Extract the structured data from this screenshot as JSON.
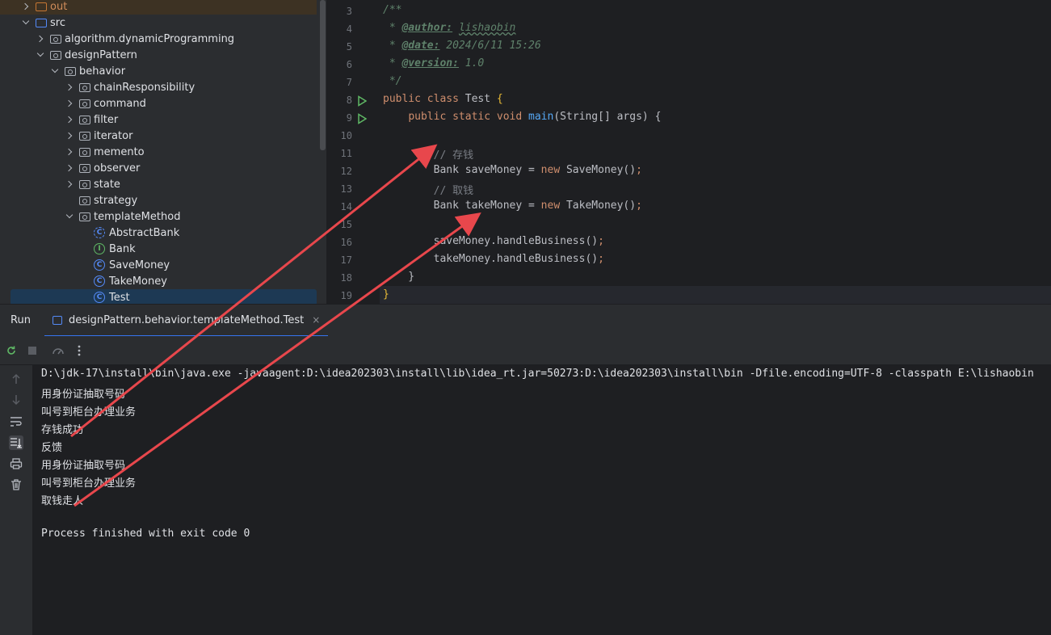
{
  "project_tree": {
    "items": [
      {
        "label": "out",
        "indent": 0,
        "chevron": "right",
        "icon": "folder-orange",
        "label_class": "orange",
        "highlight": true
      },
      {
        "label": "src",
        "indent": 0,
        "chevron": "down",
        "icon": "folder-blue"
      },
      {
        "label": "algorithm.dynamicProgramming",
        "indent": 1,
        "chevron": "right",
        "icon": "package"
      },
      {
        "label": "designPattern",
        "indent": 1,
        "chevron": "down",
        "icon": "package"
      },
      {
        "label": "behavior",
        "indent": 2,
        "chevron": "down",
        "icon": "package"
      },
      {
        "label": "chainResponsibility",
        "indent": 3,
        "chevron": "right",
        "icon": "package"
      },
      {
        "label": "command",
        "indent": 3,
        "chevron": "right",
        "icon": "package"
      },
      {
        "label": "filter",
        "indent": 3,
        "chevron": "right",
        "icon": "package"
      },
      {
        "label": "iterator",
        "indent": 3,
        "chevron": "right",
        "icon": "package"
      },
      {
        "label": "memento",
        "indent": 3,
        "chevron": "right",
        "icon": "package"
      },
      {
        "label": "observer",
        "indent": 3,
        "chevron": "right",
        "icon": "package"
      },
      {
        "label": "state",
        "indent": 3,
        "chevron": "right",
        "icon": "package"
      },
      {
        "label": "strategy",
        "indent": 3,
        "chevron": "none",
        "icon": "package"
      },
      {
        "label": "templateMethod",
        "indent": 3,
        "chevron": "down",
        "icon": "package"
      },
      {
        "label": "AbstractBank",
        "indent": 4,
        "chevron": "none",
        "icon": "abstract-class"
      },
      {
        "label": "Bank",
        "indent": 4,
        "chevron": "none",
        "icon": "interface"
      },
      {
        "label": "SaveMoney",
        "indent": 4,
        "chevron": "none",
        "icon": "class"
      },
      {
        "label": "TakeMoney",
        "indent": 4,
        "chevron": "none",
        "icon": "class"
      },
      {
        "label": "Test",
        "indent": 4,
        "chevron": "none",
        "icon": "class",
        "selected": true
      }
    ]
  },
  "editor": {
    "lines": [
      {
        "num": "3",
        "tokens": [
          [
            "cmt-doc",
            "/**"
          ]
        ]
      },
      {
        "num": "4",
        "tokens": [
          [
            "doc",
            " * "
          ],
          [
            "doctag",
            "@author:"
          ],
          [
            "doc",
            " "
          ],
          [
            "doc-u",
            "lishaobin"
          ]
        ]
      },
      {
        "num": "5",
        "tokens": [
          [
            "doc",
            " * "
          ],
          [
            "doctag",
            "@date:"
          ],
          [
            "doc",
            " 2024/6/11 15:26"
          ]
        ]
      },
      {
        "num": "6",
        "tokens": [
          [
            "doc",
            " * "
          ],
          [
            "doctag",
            "@version:"
          ],
          [
            "doc",
            " 1.0"
          ]
        ]
      },
      {
        "num": "7",
        "tokens": [
          [
            "doc",
            " */"
          ]
        ]
      },
      {
        "num": "8",
        "run": true,
        "tokens": [
          [
            "kw",
            "public class "
          ],
          [
            "plain",
            "Test "
          ],
          [
            "brace",
            "{"
          ]
        ]
      },
      {
        "num": "9",
        "run": true,
        "tokens": [
          [
            "plain",
            "    "
          ],
          [
            "kw",
            "public static void "
          ],
          [
            "fn",
            "main"
          ],
          [
            "plain",
            "(String[] args) {"
          ]
        ]
      },
      {
        "num": "10",
        "tokens": []
      },
      {
        "num": "11",
        "tokens": [
          [
            "plain",
            "        "
          ],
          [
            "cmt",
            "// 存钱"
          ]
        ]
      },
      {
        "num": "12",
        "tokens": [
          [
            "plain",
            "        Bank saveMoney = "
          ],
          [
            "kw",
            "new "
          ],
          [
            "plain",
            "SaveMoney()"
          ],
          [
            "kw",
            ";"
          ]
        ]
      },
      {
        "num": "13",
        "tokens": [
          [
            "plain",
            "        "
          ],
          [
            "cmt",
            "// 取钱"
          ]
        ]
      },
      {
        "num": "14",
        "tokens": [
          [
            "plain",
            "        Bank takeMoney = "
          ],
          [
            "kw",
            "new "
          ],
          [
            "plain",
            "TakeMoney()"
          ],
          [
            "kw",
            ";"
          ]
        ]
      },
      {
        "num": "15",
        "tokens": []
      },
      {
        "num": "16",
        "tokens": [
          [
            "plain",
            "        saveMoney.handleBusiness()"
          ],
          [
            "kw",
            ";"
          ]
        ]
      },
      {
        "num": "17",
        "tokens": [
          [
            "plain",
            "        takeMoney.handleBusiness()"
          ],
          [
            "kw",
            ";"
          ]
        ]
      },
      {
        "num": "18",
        "tokens": [
          [
            "plain",
            "    }"
          ]
        ]
      },
      {
        "num": "19",
        "tokens": [
          [
            "brace",
            "}"
          ]
        ]
      }
    ]
  },
  "run_panel": {
    "title": "Run",
    "tab_label": "designPattern.behavior.templateMethod.Test",
    "tab_close": "×"
  },
  "console": {
    "lines": [
      "D:\\jdk-17\\install\\bin\\java.exe -javaagent:D:\\idea202303\\install\\lib\\idea_rt.jar=50273:D:\\idea202303\\install\\bin -Dfile.encoding=UTF-8 -classpath E:\\lishaobin",
      "用身份证抽取号码",
      "叫号到柜台办理业务",
      "存钱成功",
      "反馈",
      "用身份证抽取号码",
      "叫号到柜台办理业务",
      "取钱走人",
      "",
      "Process finished with exit code 0"
    ]
  },
  "annotation_color": "#e8474c"
}
